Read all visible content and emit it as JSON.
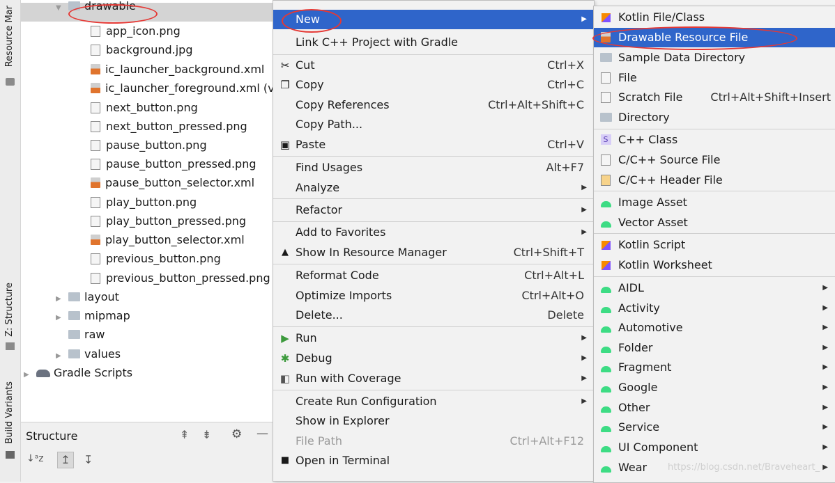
{
  "left_strip": {
    "resource_manager": "Resource Mar",
    "structure": "Z: Structure",
    "build_variants": "Build Variants"
  },
  "tree": {
    "items": [
      {
        "label": "drawable",
        "type": "folder",
        "selected": true
      },
      {
        "label": "app_icon.png",
        "type": "file"
      },
      {
        "label": "background.jpg",
        "type": "file"
      },
      {
        "label": "ic_launcher_background.xml",
        "type": "xml"
      },
      {
        "label": "ic_launcher_foreground.xml (v",
        "type": "xml"
      },
      {
        "label": "next_button.png",
        "type": "file"
      },
      {
        "label": "next_button_pressed.png",
        "type": "file"
      },
      {
        "label": "pause_button.png",
        "type": "file"
      },
      {
        "label": "pause_button_pressed.png",
        "type": "file"
      },
      {
        "label": "pause_button_selector.xml",
        "type": "xml"
      },
      {
        "label": "play_button.png",
        "type": "file"
      },
      {
        "label": "play_button_pressed.png",
        "type": "file"
      },
      {
        "label": "play_button_selector.xml",
        "type": "xml"
      },
      {
        "label": "previous_button.png",
        "type": "file"
      },
      {
        "label": "previous_button_pressed.png",
        "type": "file"
      },
      {
        "label": "layout",
        "type": "folder"
      },
      {
        "label": "mipmap",
        "type": "folder"
      },
      {
        "label": "raw",
        "type": "folder"
      },
      {
        "label": "values",
        "type": "folder"
      },
      {
        "label": "Gradle Scripts",
        "type": "gradle"
      }
    ]
  },
  "structure_panel": {
    "title": "Structure"
  },
  "context_menu": {
    "items": [
      {
        "label": "New",
        "highlight": true,
        "submenu": true
      },
      {
        "label": "Link C++ Project with Gradle"
      },
      {
        "label": "Cut",
        "shortcut": "Ctrl+X",
        "icon": "scissors-icon"
      },
      {
        "label": "Copy",
        "shortcut": "Ctrl+C",
        "icon": "copy-icon"
      },
      {
        "label": "Copy References",
        "shortcut": "Ctrl+Alt+Shift+C"
      },
      {
        "label": "Copy Path..."
      },
      {
        "label": "Paste",
        "shortcut": "Ctrl+V",
        "icon": "paste-icon"
      },
      {
        "label": "Find Usages",
        "shortcut": "Alt+F7"
      },
      {
        "label": "Analyze",
        "submenu": true
      },
      {
        "label": "Refactor",
        "submenu": true
      },
      {
        "label": "Add to Favorites",
        "submenu": true
      },
      {
        "label": "Show In Resource Manager",
        "shortcut": "Ctrl+Shift+T",
        "icon": "resource-manager-icon"
      },
      {
        "label": "Reformat Code",
        "shortcut": "Ctrl+Alt+L"
      },
      {
        "label": "Optimize Imports",
        "shortcut": "Ctrl+Alt+O"
      },
      {
        "label": "Delete...",
        "shortcut": "Delete"
      },
      {
        "label": "Run",
        "submenu": true,
        "icon": "run-icon"
      },
      {
        "label": "Debug",
        "submenu": true,
        "icon": "debug-icon"
      },
      {
        "label": "Run with Coverage",
        "submenu": true,
        "icon": "coverage-icon"
      },
      {
        "label": "Create Run Configuration",
        "submenu": true
      },
      {
        "label": "Show in Explorer"
      },
      {
        "label": "File Path",
        "shortcut": "Ctrl+Alt+F12",
        "disabled": true
      },
      {
        "label": "Open in Terminal",
        "icon": "terminal-icon"
      }
    ]
  },
  "new_submenu": {
    "items": [
      {
        "label": "Kotlin File/Class"
      },
      {
        "label": "Drawable Resource File",
        "highlight": true
      },
      {
        "label": "Sample Data Directory"
      },
      {
        "label": "File"
      },
      {
        "label": "Scratch File",
        "shortcut": "Ctrl+Alt+Shift+Insert"
      },
      {
        "label": "Directory"
      },
      {
        "label": "C++ Class"
      },
      {
        "label": "C/C++ Source File"
      },
      {
        "label": "C/C++ Header File"
      },
      {
        "label": "Image Asset"
      },
      {
        "label": "Vector Asset"
      },
      {
        "label": "Kotlin Script"
      },
      {
        "label": "Kotlin Worksheet"
      },
      {
        "label": "AIDL",
        "submenu": true
      },
      {
        "label": "Activity",
        "submenu": true
      },
      {
        "label": "Automotive",
        "submenu": true
      },
      {
        "label": "Folder",
        "submenu": true
      },
      {
        "label": "Fragment",
        "submenu": true
      },
      {
        "label": "Google",
        "submenu": true
      },
      {
        "label": "Other",
        "submenu": true
      },
      {
        "label": "Service",
        "submenu": true
      },
      {
        "label": "UI Component",
        "submenu": true
      },
      {
        "label": "Wear",
        "submenu": true
      }
    ]
  },
  "watermark": "https://blog.csdn.net/Braveheart_",
  "colors": {
    "highlight": "#2f65ca",
    "annotation": "#e53935"
  }
}
